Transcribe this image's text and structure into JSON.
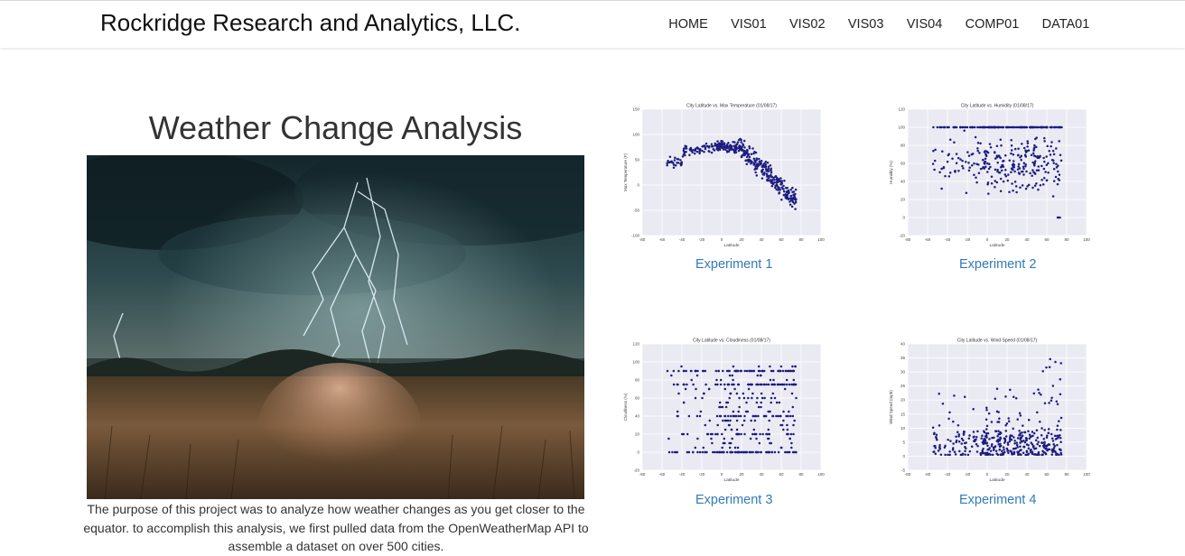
{
  "navbar": {
    "brand": "Rockridge Research and Analytics, LLC.",
    "links": [
      "HOME",
      "VIS01",
      "VIS02",
      "VIS03",
      "VIS04",
      "COMP01",
      "DATA01"
    ]
  },
  "main": {
    "title": "Weather Change Analysis",
    "description": "The purpose of this project was to analyze how weather changes as you get closer to the equator. to accomplish this analysis, we first pulled data from the OpenWeatherMap API to assemble a dataset on over 500 cities."
  },
  "experiments": [
    {
      "label": "Experiment 1"
    },
    {
      "label": "Experiment 2"
    },
    {
      "label": "Experiment 3"
    },
    {
      "label": "Experiment 4"
    }
  ],
  "colors": {
    "link": "#337ab7",
    "plot_bg": "#eaeaf2",
    "point": "#1c1c80"
  },
  "chart_data": [
    {
      "type": "scatter",
      "title": "City Latitude vs. Max Temperature (01/08/17)",
      "xlabel": "Latitude",
      "ylabel": "Max Temperature (F)",
      "xlim": [
        -80,
        100
      ],
      "ylim": [
        -100,
        150
      ],
      "xticks": [
        -80,
        -60,
        -40,
        -20,
        0,
        20,
        40,
        60,
        80,
        100
      ],
      "yticks": [
        -100,
        -50,
        0,
        50,
        100,
        150
      ],
      "series": [
        {
          "pattern": "temp"
        }
      ]
    },
    {
      "type": "scatter",
      "title": "City Latitude vs. Humidity (01/08/17)",
      "xlabel": "Latitude",
      "ylabel": "Humidity (%)",
      "xlim": [
        -80,
        100
      ],
      "ylim": [
        -20,
        120
      ],
      "xticks": [
        -80,
        -60,
        -40,
        -20,
        0,
        20,
        40,
        60,
        80,
        100
      ],
      "yticks": [
        -20,
        0,
        20,
        40,
        60,
        80,
        100,
        120
      ],
      "series": [
        {
          "pattern": "humidity"
        }
      ]
    },
    {
      "type": "scatter",
      "title": "City Latitude vs. Cloudiness (01/08/17)",
      "xlabel": "Latitude",
      "ylabel": "Cloudiness (%)",
      "xlim": [
        -80,
        100
      ],
      "ylim": [
        -20,
        120
      ],
      "xticks": [
        -80,
        -60,
        -40,
        -20,
        0,
        20,
        40,
        60,
        80,
        100
      ],
      "yticks": [
        -20,
        0,
        20,
        40,
        60,
        80,
        100,
        120
      ],
      "series": [
        {
          "pattern": "cloud"
        }
      ]
    },
    {
      "type": "scatter",
      "title": "City Latitude vs. Wind Speed (01/08/17)",
      "xlabel": "Latitude",
      "ylabel": "Wind Speed (mph)",
      "xlim": [
        -80,
        100
      ],
      "ylim": [
        -5,
        40
      ],
      "xticks": [
        -80,
        -60,
        -40,
        -20,
        0,
        20,
        40,
        60,
        80,
        100
      ],
      "yticks": [
        -5,
        0,
        5,
        10,
        15,
        20,
        25,
        30,
        35,
        40
      ],
      "series": [
        {
          "pattern": "wind"
        }
      ]
    }
  ]
}
